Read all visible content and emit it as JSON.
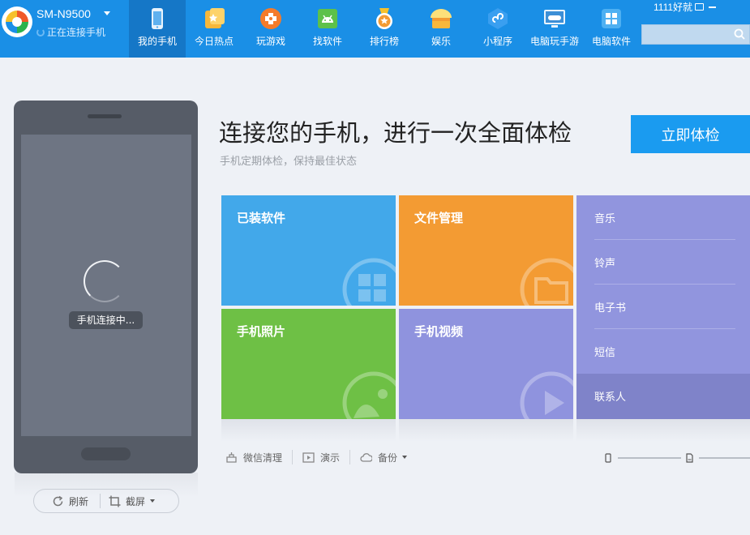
{
  "header": {
    "device_name": "SM-N9500",
    "device_status": "正在连接手机",
    "username": "1111好就",
    "search_placeholder": ""
  },
  "nav": {
    "items": [
      {
        "label": "我的手机",
        "icon": "phone-icon"
      },
      {
        "label": "今日热点",
        "icon": "hot-star-icon"
      },
      {
        "label": "玩游戏",
        "icon": "gamepad-icon"
      },
      {
        "label": "找软件",
        "icon": "android-icon"
      },
      {
        "label": "排行榜",
        "icon": "medal-icon"
      },
      {
        "label": "娱乐",
        "icon": "entertainment-box-icon"
      },
      {
        "label": "小程序",
        "icon": "miniprogram-icon"
      },
      {
        "label": "电脑玩手游",
        "icon": "pc-game-icon"
      },
      {
        "label": "电脑软件",
        "icon": "pc-software-icon"
      }
    ],
    "active_index": 0
  },
  "phone": {
    "connecting_text": "手机连接中...",
    "refresh_label": "刷新",
    "screenshot_label": "截屏"
  },
  "main": {
    "headline": "连接您的手机，进行一次全面体检",
    "subline": "手机定期体检，保持最佳状态",
    "check_button": "立即体检"
  },
  "tiles": {
    "apps": "已装软件",
    "files": "文件管理",
    "photos": "手机照片",
    "videos": "手机视频"
  },
  "list": [
    "音乐",
    "铃声",
    "电子书",
    "短信",
    "联系人"
  ],
  "toolbar": {
    "wechat_clean": "微信清理",
    "demo": "演示",
    "backup": "备份"
  },
  "colors": {
    "brand": "#1a8fe6",
    "apps_tile": "#42a8ea",
    "files_tile": "#f39b33",
    "photos_tile": "#6ec045",
    "videos_tile": "#8f93de",
    "list_panel": "#9195de",
    "check_button": "#1a9bf0"
  }
}
